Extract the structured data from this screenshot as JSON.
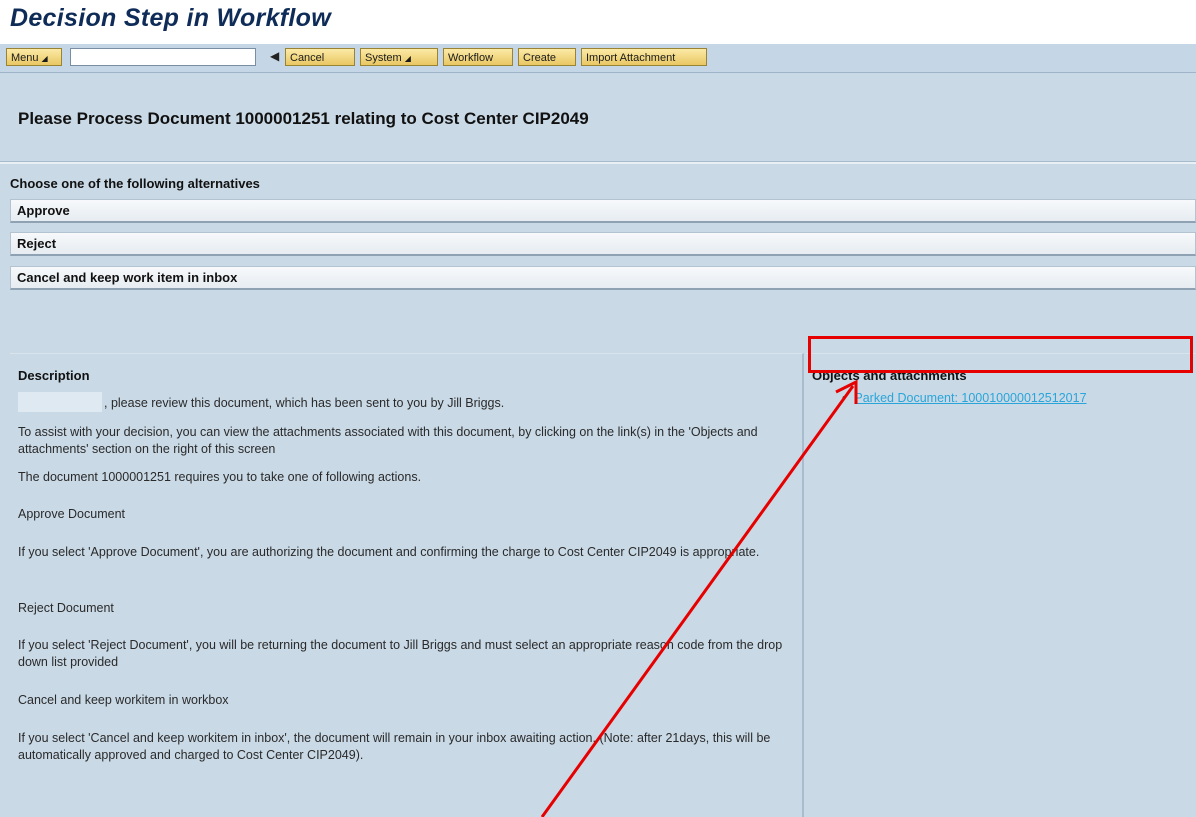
{
  "window": {
    "title": "Decision Step in Workflow"
  },
  "toolbar": {
    "menu_label": "Menu",
    "command_value": "",
    "buttons": [
      "Cancel",
      "System",
      "Workflow",
      "Create",
      "Import Attachment"
    ]
  },
  "main": {
    "heading": "Please Process Document 1000001251 relating to Cost Center CIP2049",
    "choose_label": "Choose one of the following alternatives",
    "alternatives": [
      "Approve",
      "Reject",
      "Cancel and keep work item in inbox"
    ]
  },
  "description": {
    "title": "Description",
    "line1": ", please review this document, which has been sent to you by Jill Briggs.",
    "para2": "To assist with your decision, you can view the attachments associated with this document, by clicking on the link(s) in the 'Objects and attachments' section on the right of this screen",
    "para3": "The document 1000001251 requires you to take one of following actions.",
    "para4": "Approve Document",
    "para5": "If you select 'Approve Document', you are authorizing the document and confirming the charge to Cost Center CIP2049 is appropriate.",
    "para6": "Reject Document",
    "para7": "If you select 'Reject Document', you will be returning the document to Jill Briggs and must select an appropriate reason code from the drop down list provided",
    "para8": "Cancel and keep workitem in workbox",
    "para9": "If you select 'Cancel and keep workitem in inbox', the document will remain in your inbox awaiting action. (Note: after 21days, this will be automatically approved and charged to Cost Center CIP2049)."
  },
  "objects": {
    "title": "Objects and attachments",
    "items": [
      "Parked Document: 100010000012512017"
    ]
  },
  "colors": {
    "annotation": "#e60000",
    "link": "#2aa5d9",
    "toolbar_button": "#f0d37a"
  }
}
